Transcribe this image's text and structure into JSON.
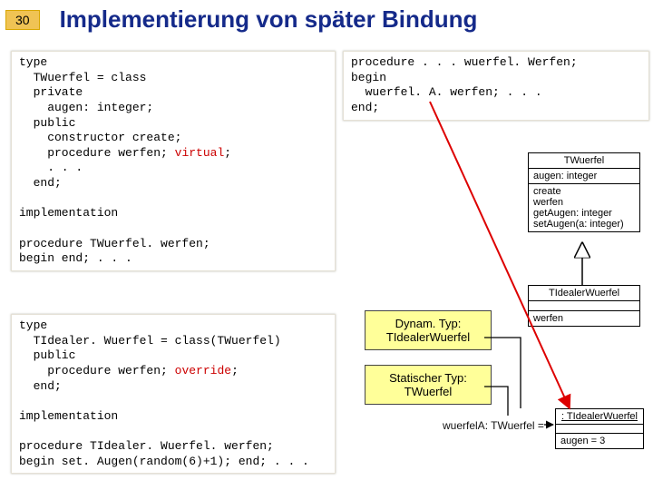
{
  "page_number": "30",
  "title": "Implementierung von später Bindung",
  "code_top_left": {
    "l1": "type",
    "l2": "  TWuerfel = class",
    "l3": "  private",
    "l4": "    augen: integer;",
    "l5": "  public",
    "l6": "    constructor create;",
    "l7a": "    procedure werfen; ",
    "l7b": "virtual",
    "l7c": ";",
    "l8": "    . . .",
    "l9": "  end;",
    "blank": "",
    "l10": "implementation",
    "l11": "procedure TWuerfel. werfen;",
    "l12": "begin end; . . ."
  },
  "code_bottom_left": {
    "l1": "type",
    "l2": "  TIdealer. Wuerfel = class(TWuerfel)",
    "l3": "  public",
    "l4a": "    procedure werfen; ",
    "l4b": "override",
    "l4c": ";",
    "l5": "  end;",
    "blank": "",
    "l6": "implementation",
    "l7": "procedure TIdealer. Wuerfel. werfen;",
    "l8": "begin set. Augen(random(6)+1); end; . . ."
  },
  "code_top_right": {
    "l1": "procedure . . . wuerfel. Werfen;",
    "l2": "begin",
    "l3": "  wuerfel. A. werfen; . . .",
    "l4": "end;"
  },
  "uml_twuerfel": {
    "title": "TWuerfel",
    "attrs": "augen: integer",
    "ops1": "create",
    "ops2": "werfen",
    "ops3": "getAugen: integer",
    "ops4": "setAugen(a: integer)"
  },
  "uml_tidealer": {
    "title": "TIdealerWuerfel",
    "ops": "werfen"
  },
  "uml_instance": {
    "title": ": TIdealerWuerfel",
    "attr": "augen = 3"
  },
  "obj_label": "wuerfelA: TWuerfel =",
  "callout_dynamic": "Dynam. Typ:\nTIdealerWuerfel",
  "callout_static": "Statischer Typ:\nTWuerfel"
}
